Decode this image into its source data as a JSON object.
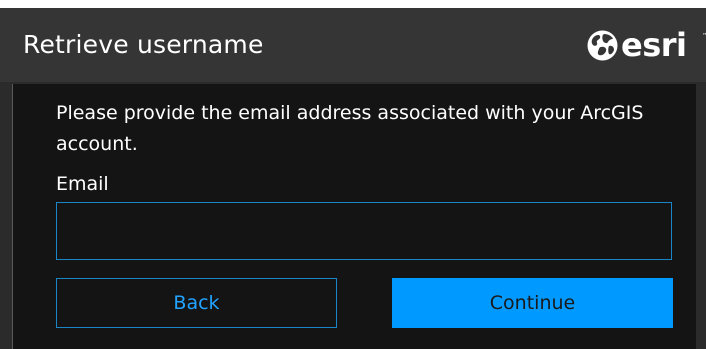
{
  "header": {
    "title": "Retrieve username",
    "logo_text": "esri",
    "logo_tm": "™"
  },
  "form": {
    "instructions": "Please provide the email address associated with your ArcGIS account.",
    "email_label": "Email",
    "email_value": "",
    "email_placeholder": ""
  },
  "buttons": {
    "back_label": "Back",
    "continue_label": "Continue"
  },
  "icons": {
    "logo_globe": "globe-icon"
  },
  "colors": {
    "header_bg": "#353535",
    "body_bg": "#141414",
    "accent": "#0099ff",
    "border_accent": "#1a86c8"
  }
}
